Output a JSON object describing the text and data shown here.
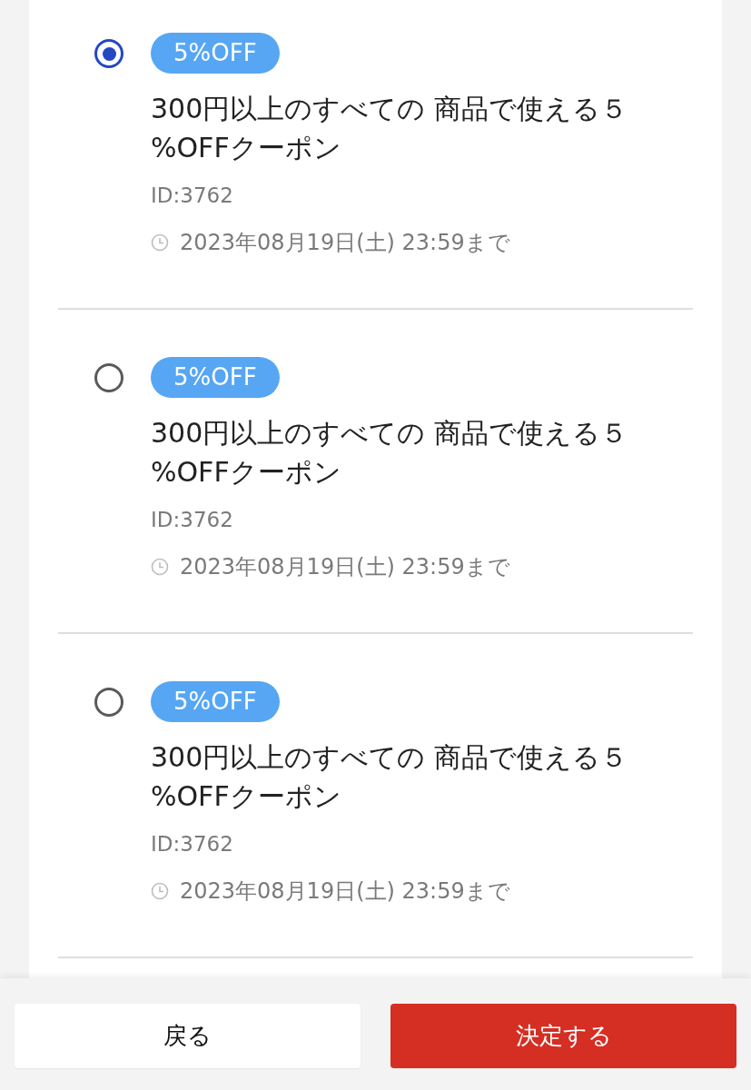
{
  "coupons": [
    {
      "selected": true,
      "badge": "5%OFF",
      "title": "300円以上のすべての 商品で使える５%OFFクーポン",
      "id": "ID:3762",
      "expiry": "2023年08月19日(土) 23:59まで"
    },
    {
      "selected": false,
      "badge": "5%OFF",
      "title": "300円以上のすべての 商品で使える５%OFFクーポン",
      "id": "ID:3762",
      "expiry": "2023年08月19日(土) 23:59まで"
    },
    {
      "selected": false,
      "badge": "5%OFF",
      "title": "300円以上のすべての 商品で使える５%OFFクーポン",
      "id": "ID:3762",
      "expiry": "2023年08月19日(土) 23:59まで"
    }
  ],
  "buttons": [
    {
      "kind": "secondary",
      "label": "戻る"
    },
    {
      "kind": "primary",
      "label": "決定する"
    }
  ]
}
